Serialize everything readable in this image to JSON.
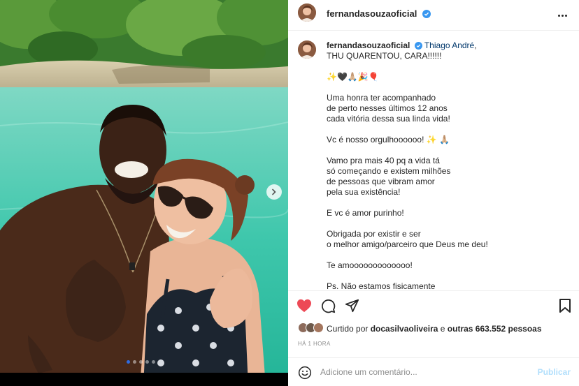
{
  "post": {
    "username": "fernandasouzaoficial",
    "mention": "Thiago André",
    "caption_lines": [
      ", ",
      "THU QUARENTOU, CARA!!!!!!"
    ],
    "emoji_line": "✨🖤🙏🏼🎉🎈",
    "paragraphs": [
      [
        "Uma honra ter acompanhado",
        "de perto nesses últimos 12 anos",
        "cada vitória dessa sua linda vida!"
      ],
      [
        "Vc é nosso orgulhoooooo! ✨ 🙏🏼"
      ],
      [
        "Vamo pra mais 40 pq a vida tá",
        "só começando e existem milhões",
        "de pessoas que vibram amor",
        "pela sua existência!"
      ],
      [
        "E vc é amor purinho!"
      ],
      [
        "Obrigada por existir e ser",
        "o melhor amigo/parceiro que Deus me deu!"
      ],
      [
        "Te amooooooooooooo!"
      ],
      [
        "Ps. Não estamos fisicamente"
      ]
    ]
  },
  "likes": {
    "prefix": "Curtido por ",
    "user": "docasilvaoliveira",
    "middle": " e ",
    "others": "outras 663.552 pessoas"
  },
  "timestamp": "HÁ 1 HORA",
  "comment": {
    "placeholder": "Adicione um comentário...",
    "publish_label": "Publicar"
  },
  "colors": {
    "verified": "#3897f0",
    "like_red": "#ed4956",
    "publish_disabled": "#b2dffc",
    "mention": "#00376b"
  },
  "carousel": {
    "slides": 5,
    "current": 1
  }
}
